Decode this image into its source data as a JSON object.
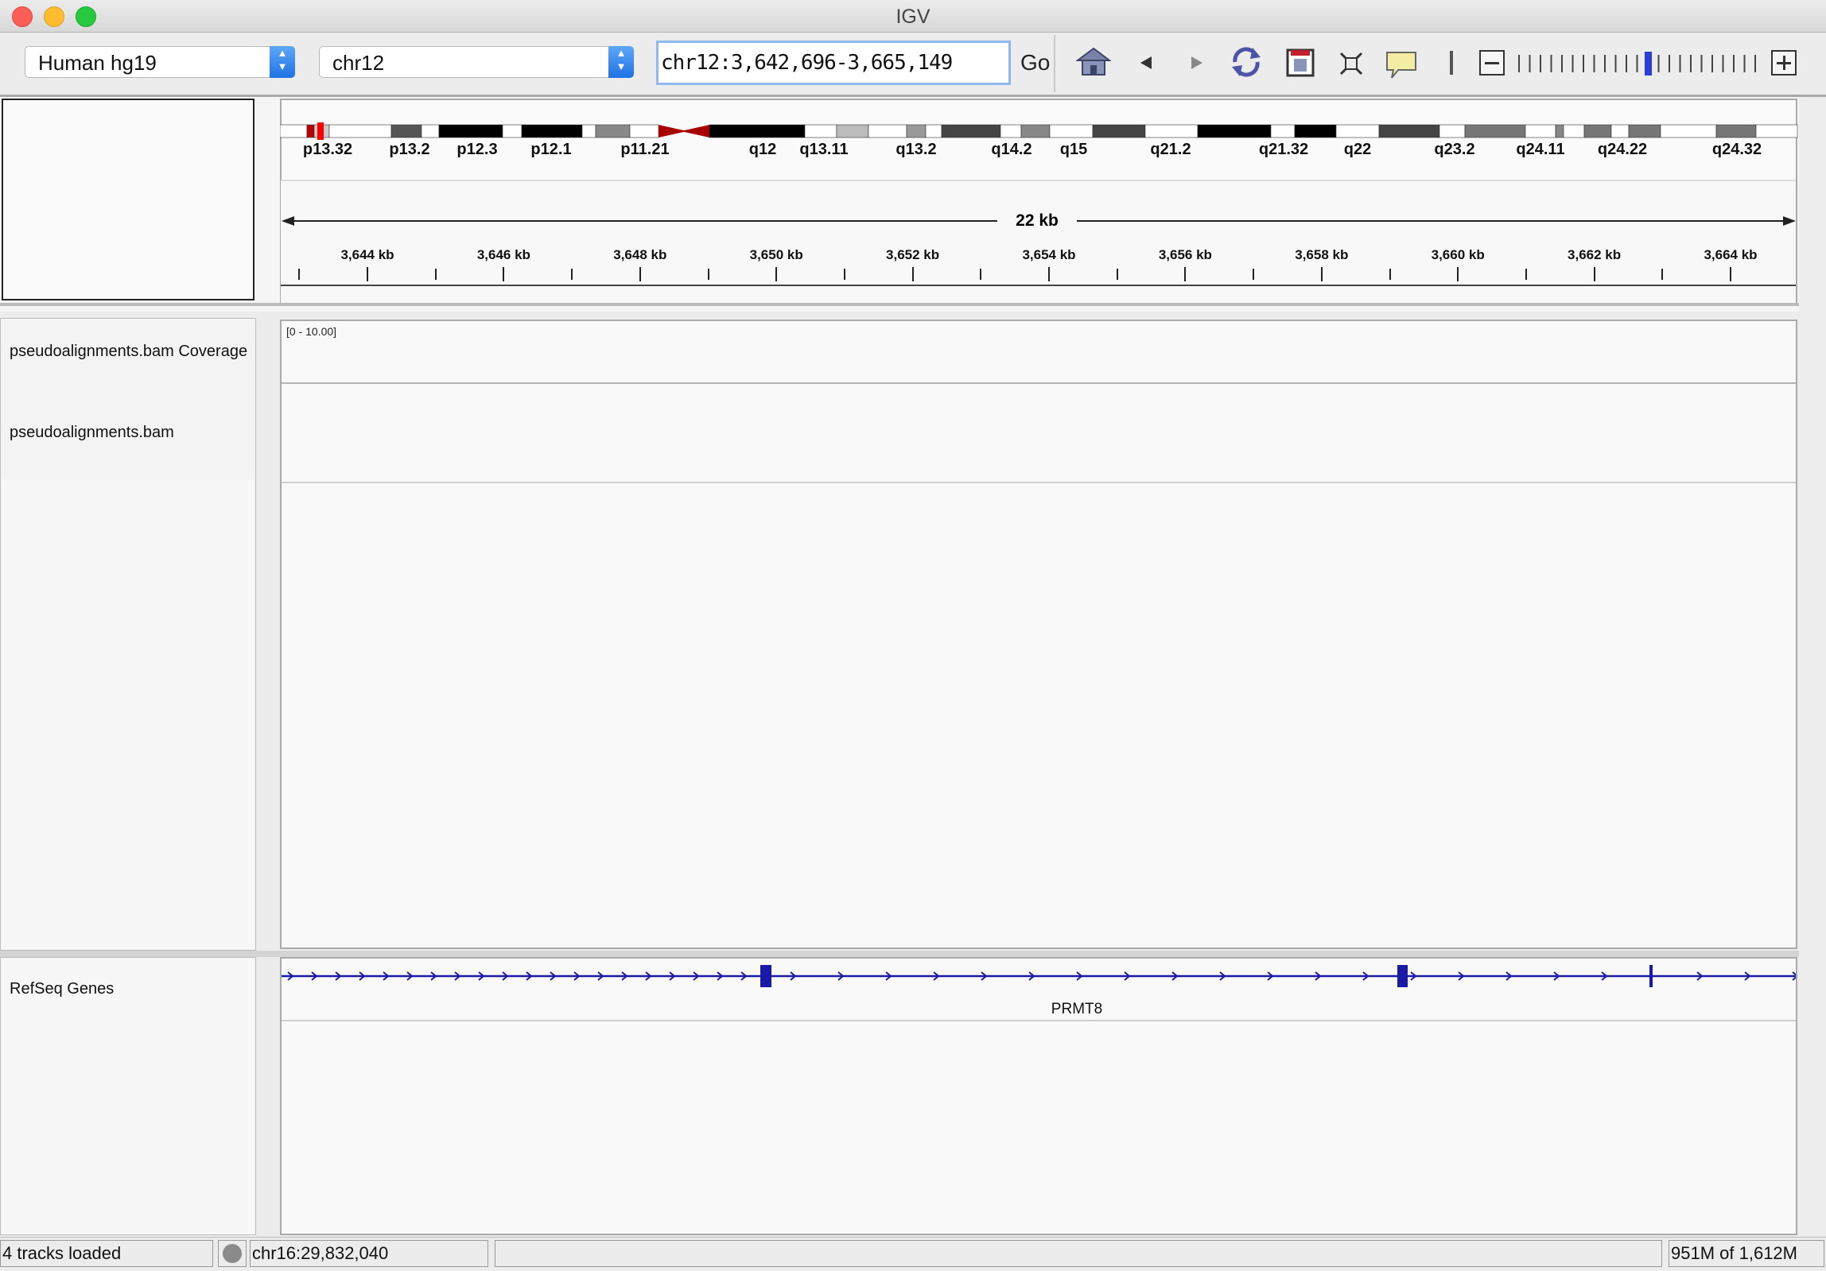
{
  "window": {
    "title": "IGV"
  },
  "toolbar": {
    "genome": "Human hg19",
    "chromosome": "chr12",
    "locus": "chr12:3,642,696-3,665,149",
    "go_label": "Go"
  },
  "ideogram": {
    "bands": [
      "p13.32",
      "p13.2",
      "p12.3",
      "p12.1",
      "p11.21",
      "q12",
      "q13.11",
      "q13.2",
      "q14.2",
      "q15",
      "q21.2",
      "q21.32",
      "q22",
      "q23.2",
      "q24.11",
      "q24.22",
      "q24.32"
    ]
  },
  "ruler": {
    "span_label": "22 kb",
    "ticks": [
      "3,644 kb",
      "3,646 kb",
      "3,648 kb",
      "3,650 kb",
      "3,652 kb",
      "3,654 kb",
      "3,656 kb",
      "3,658 kb",
      "3,660 kb",
      "3,662 kb",
      "3,664 kb"
    ]
  },
  "tracks": {
    "coverage": {
      "name": "pseudoalignments.bam Coverage",
      "range": "[0 - 10.00]"
    },
    "alignments": {
      "name": "pseudoalignments.bam"
    },
    "genes": {
      "name": "RefSeq Genes",
      "gene": "PRMT8"
    }
  },
  "status": {
    "tracks_loaded": "4 tracks loaded",
    "position": "chr16:29,832,040",
    "memory": "951M of 1,612M"
  },
  "colors": {
    "gene": "#1a1aa6",
    "accent": "#1f71e5",
    "centromere": "#b30000"
  }
}
